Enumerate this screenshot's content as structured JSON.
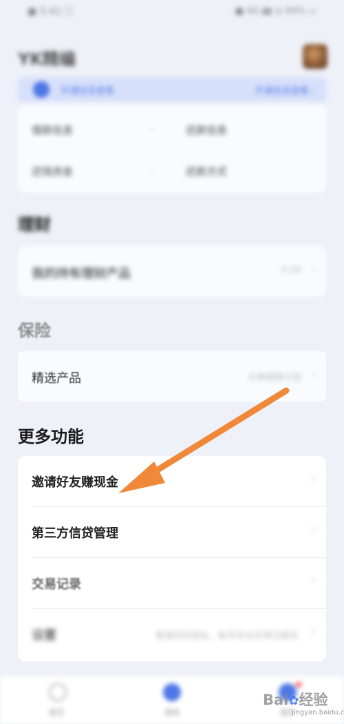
{
  "status_bar": {
    "left": "■ 5:41 ☐",
    "right": "■ 4G ▮▮ ◎ 94% ▭"
  },
  "header": {
    "title": "YK精编"
  },
  "banner": {
    "text": "开通信息查看",
    "action": "开通信息查看 ›"
  },
  "grid": {
    "cells": [
      {
        "label": "借款信息"
      },
      {
        "label": "还款信息"
      },
      {
        "label": "还钱资金"
      },
      {
        "label": "还款方式"
      }
    ]
  },
  "sections": {
    "s1_title": "理财",
    "s1_row_label": "我的持有理财产品",
    "s1_row_value": "0.00",
    "insurance_title": "保险",
    "insurance_row_label": "精选产品",
    "insurance_row_value": "大病保障计划",
    "more_title": "更多功能"
  },
  "more_items": [
    {
      "label": "邀请好友赚现金"
    },
    {
      "label": "第三方信贷管理"
    },
    {
      "label": "交易记录"
    },
    {
      "label": "设置",
      "value": "管理您的隐私、账号安全及常见服务"
    }
  ],
  "chevron": "›",
  "tabbar": {
    "tabs": [
      {
        "label": "首页",
        "icon": "home-icon"
      },
      {
        "label": "借钱",
        "icon": "loan-icon"
      },
      {
        "label": "我的",
        "icon": "profile-icon"
      }
    ]
  },
  "watermark": {
    "brand": "Bai",
    "brand_suffix": "经验",
    "sub": "jingyan.baidu.com"
  },
  "annotation": {
    "color": "#f0883a"
  },
  "colors": {
    "accent": "#4d77e6",
    "background": "#eef1f8",
    "arrow": "#f0883a"
  }
}
